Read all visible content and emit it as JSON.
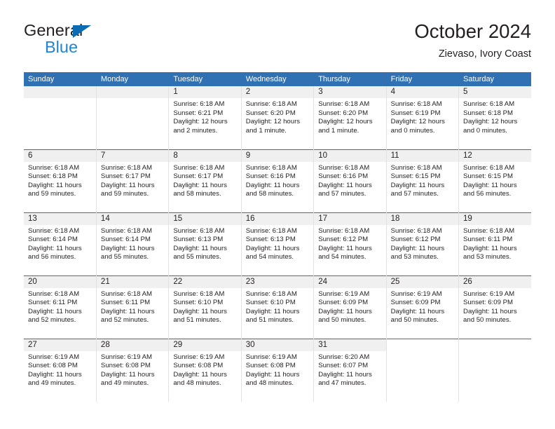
{
  "brand": {
    "name_part1": "General",
    "name_part2": "Blue",
    "accent_color": "#1f84d6",
    "triangle_color": "#0b6cb3"
  },
  "header": {
    "title": "October 2024",
    "subtitle": "Zievaso, Ivory Coast"
  },
  "calendar": {
    "header_bg": "#3071b4",
    "daynum_bg": "#f0f0f0",
    "weekdays": [
      "Sunday",
      "Monday",
      "Tuesday",
      "Wednesday",
      "Thursday",
      "Friday",
      "Saturday"
    ],
    "weeks": [
      [
        {
          "day": "",
          "empty": true,
          "blank": false,
          "sunrise": "",
          "sunset": "",
          "daylight": ""
        },
        {
          "day": "",
          "empty": true,
          "blank": false,
          "sunrise": "",
          "sunset": "",
          "daylight": ""
        },
        {
          "day": "1",
          "empty": false,
          "blank": false,
          "sunrise": "Sunrise: 6:18 AM",
          "sunset": "Sunset: 6:21 PM",
          "daylight": "Daylight: 12 hours and 2 minutes."
        },
        {
          "day": "2",
          "empty": false,
          "blank": false,
          "sunrise": "Sunrise: 6:18 AM",
          "sunset": "Sunset: 6:20 PM",
          "daylight": "Daylight: 12 hours and 1 minute."
        },
        {
          "day": "3",
          "empty": false,
          "blank": false,
          "sunrise": "Sunrise: 6:18 AM",
          "sunset": "Sunset: 6:20 PM",
          "daylight": "Daylight: 12 hours and 1 minute."
        },
        {
          "day": "4",
          "empty": false,
          "blank": false,
          "sunrise": "Sunrise: 6:18 AM",
          "sunset": "Sunset: 6:19 PM",
          "daylight": "Daylight: 12 hours and 0 minutes."
        },
        {
          "day": "5",
          "empty": false,
          "blank": false,
          "sunrise": "Sunrise: 6:18 AM",
          "sunset": "Sunset: 6:18 PM",
          "daylight": "Daylight: 12 hours and 0 minutes."
        }
      ],
      [
        {
          "day": "6",
          "empty": false,
          "blank": false,
          "sunrise": "Sunrise: 6:18 AM",
          "sunset": "Sunset: 6:18 PM",
          "daylight": "Daylight: 11 hours and 59 minutes."
        },
        {
          "day": "7",
          "empty": false,
          "blank": false,
          "sunrise": "Sunrise: 6:18 AM",
          "sunset": "Sunset: 6:17 PM",
          "daylight": "Daylight: 11 hours and 59 minutes."
        },
        {
          "day": "8",
          "empty": false,
          "blank": false,
          "sunrise": "Sunrise: 6:18 AM",
          "sunset": "Sunset: 6:17 PM",
          "daylight": "Daylight: 11 hours and 58 minutes."
        },
        {
          "day": "9",
          "empty": false,
          "blank": false,
          "sunrise": "Sunrise: 6:18 AM",
          "sunset": "Sunset: 6:16 PM",
          "daylight": "Daylight: 11 hours and 58 minutes."
        },
        {
          "day": "10",
          "empty": false,
          "blank": false,
          "sunrise": "Sunrise: 6:18 AM",
          "sunset": "Sunset: 6:16 PM",
          "daylight": "Daylight: 11 hours and 57 minutes."
        },
        {
          "day": "11",
          "empty": false,
          "blank": false,
          "sunrise": "Sunrise: 6:18 AM",
          "sunset": "Sunset: 6:15 PM",
          "daylight": "Daylight: 11 hours and 57 minutes."
        },
        {
          "day": "12",
          "empty": false,
          "blank": false,
          "sunrise": "Sunrise: 6:18 AM",
          "sunset": "Sunset: 6:15 PM",
          "daylight": "Daylight: 11 hours and 56 minutes."
        }
      ],
      [
        {
          "day": "13",
          "empty": false,
          "blank": false,
          "sunrise": "Sunrise: 6:18 AM",
          "sunset": "Sunset: 6:14 PM",
          "daylight": "Daylight: 11 hours and 56 minutes."
        },
        {
          "day": "14",
          "empty": false,
          "blank": false,
          "sunrise": "Sunrise: 6:18 AM",
          "sunset": "Sunset: 6:14 PM",
          "daylight": "Daylight: 11 hours and 55 minutes."
        },
        {
          "day": "15",
          "empty": false,
          "blank": false,
          "sunrise": "Sunrise: 6:18 AM",
          "sunset": "Sunset: 6:13 PM",
          "daylight": "Daylight: 11 hours and 55 minutes."
        },
        {
          "day": "16",
          "empty": false,
          "blank": false,
          "sunrise": "Sunrise: 6:18 AM",
          "sunset": "Sunset: 6:13 PM",
          "daylight": "Daylight: 11 hours and 54 minutes."
        },
        {
          "day": "17",
          "empty": false,
          "blank": false,
          "sunrise": "Sunrise: 6:18 AM",
          "sunset": "Sunset: 6:12 PM",
          "daylight": "Daylight: 11 hours and 54 minutes."
        },
        {
          "day": "18",
          "empty": false,
          "blank": false,
          "sunrise": "Sunrise: 6:18 AM",
          "sunset": "Sunset: 6:12 PM",
          "daylight": "Daylight: 11 hours and 53 minutes."
        },
        {
          "day": "19",
          "empty": false,
          "blank": false,
          "sunrise": "Sunrise: 6:18 AM",
          "sunset": "Sunset: 6:11 PM",
          "daylight": "Daylight: 11 hours and 53 minutes."
        }
      ],
      [
        {
          "day": "20",
          "empty": false,
          "blank": false,
          "sunrise": "Sunrise: 6:18 AM",
          "sunset": "Sunset: 6:11 PM",
          "daylight": "Daylight: 11 hours and 52 minutes."
        },
        {
          "day": "21",
          "empty": false,
          "blank": false,
          "sunrise": "Sunrise: 6:18 AM",
          "sunset": "Sunset: 6:11 PM",
          "daylight": "Daylight: 11 hours and 52 minutes."
        },
        {
          "day": "22",
          "empty": false,
          "blank": false,
          "sunrise": "Sunrise: 6:18 AM",
          "sunset": "Sunset: 6:10 PM",
          "daylight": "Daylight: 11 hours and 51 minutes."
        },
        {
          "day": "23",
          "empty": false,
          "blank": false,
          "sunrise": "Sunrise: 6:18 AM",
          "sunset": "Sunset: 6:10 PM",
          "daylight": "Daylight: 11 hours and 51 minutes."
        },
        {
          "day": "24",
          "empty": false,
          "blank": false,
          "sunrise": "Sunrise: 6:19 AM",
          "sunset": "Sunset: 6:09 PM",
          "daylight": "Daylight: 11 hours and 50 minutes."
        },
        {
          "day": "25",
          "empty": false,
          "blank": false,
          "sunrise": "Sunrise: 6:19 AM",
          "sunset": "Sunset: 6:09 PM",
          "daylight": "Daylight: 11 hours and 50 minutes."
        },
        {
          "day": "26",
          "empty": false,
          "blank": false,
          "sunrise": "Sunrise: 6:19 AM",
          "sunset": "Sunset: 6:09 PM",
          "daylight": "Daylight: 11 hours and 50 minutes."
        }
      ],
      [
        {
          "day": "27",
          "empty": false,
          "blank": false,
          "sunrise": "Sunrise: 6:19 AM",
          "sunset": "Sunset: 6:08 PM",
          "daylight": "Daylight: 11 hours and 49 minutes."
        },
        {
          "day": "28",
          "empty": false,
          "blank": false,
          "sunrise": "Sunrise: 6:19 AM",
          "sunset": "Sunset: 6:08 PM",
          "daylight": "Daylight: 11 hours and 49 minutes."
        },
        {
          "day": "29",
          "empty": false,
          "blank": false,
          "sunrise": "Sunrise: 6:19 AM",
          "sunset": "Sunset: 6:08 PM",
          "daylight": "Daylight: 11 hours and 48 minutes."
        },
        {
          "day": "30",
          "empty": false,
          "blank": false,
          "sunrise": "Sunrise: 6:19 AM",
          "sunset": "Sunset: 6:08 PM",
          "daylight": "Daylight: 11 hours and 48 minutes."
        },
        {
          "day": "31",
          "empty": false,
          "blank": false,
          "sunrise": "Sunrise: 6:20 AM",
          "sunset": "Sunset: 6:07 PM",
          "daylight": "Daylight: 11 hours and 47 minutes."
        },
        {
          "day": "",
          "empty": true,
          "blank": true,
          "sunrise": "",
          "sunset": "",
          "daylight": ""
        },
        {
          "day": "",
          "empty": true,
          "blank": true,
          "sunrise": "",
          "sunset": "",
          "daylight": ""
        }
      ]
    ]
  }
}
